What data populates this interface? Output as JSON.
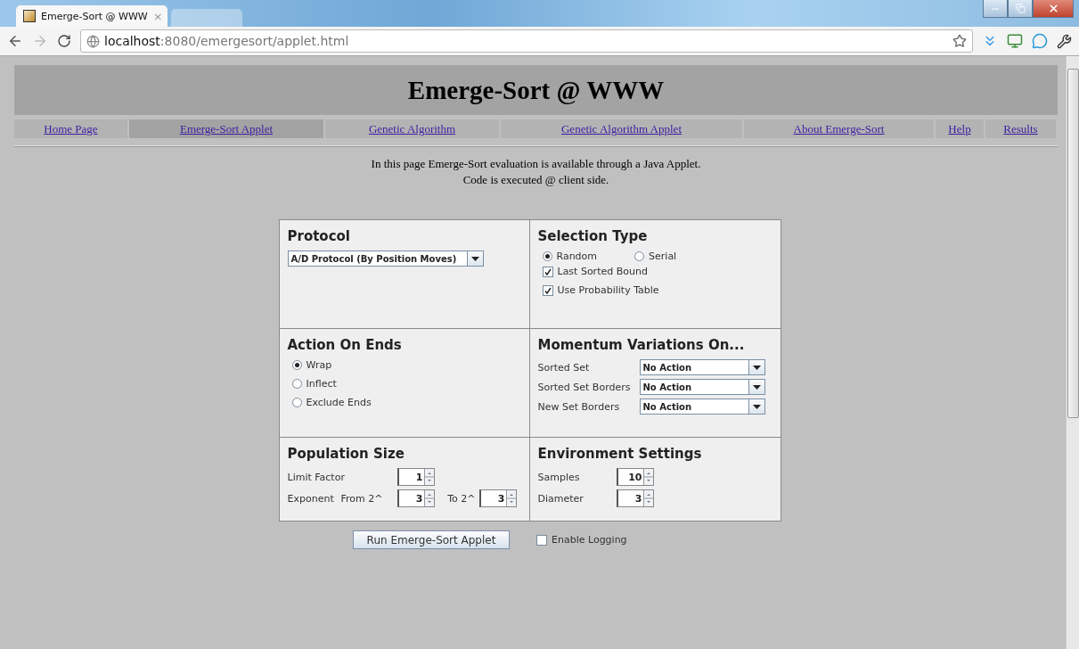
{
  "browser": {
    "tab_title": "Emerge-Sort @ WWW",
    "tab_close": "×",
    "url_host": "localhost",
    "url_rest": ":8080/emergesort/applet.html"
  },
  "page_title": "Emerge-Sort @ WWW",
  "nav": [
    {
      "label": "Home Page",
      "selected": false
    },
    {
      "label": "Emerge-Sort Applet",
      "selected": true
    },
    {
      "label": "Genetic Algorithm",
      "selected": false
    },
    {
      "label": "Genetic Algorithm Applet",
      "selected": false
    },
    {
      "label": "About Emerge-Sort",
      "selected": false
    },
    {
      "label": "Help",
      "selected": false
    },
    {
      "label": "Results",
      "selected": false
    }
  ],
  "intro": [
    "In this page Emerge-Sort evaluation is available through a Java Applet.",
    "Code is executed @ client side."
  ],
  "protocol": {
    "title": "Protocol",
    "dropdown": "A/D Protocol (By Position Moves)"
  },
  "selection_type": {
    "title": "Selection Type",
    "radios": [
      {
        "label": "Random",
        "selected": true
      },
      {
        "label": "Serial",
        "selected": false
      }
    ],
    "checkboxes": [
      {
        "label": "Last Sorted Bound",
        "checked": true
      },
      {
        "label": "Use Probability Table",
        "checked": true
      }
    ]
  },
  "action_on_ends": {
    "title": "Action On Ends",
    "radios": [
      {
        "label": "Wrap",
        "selected": true
      },
      {
        "label": "Inflect",
        "selected": false
      },
      {
        "label": "Exclude Ends",
        "selected": false
      }
    ]
  },
  "momentum": {
    "title": "Momentum Variations On...",
    "rows": [
      {
        "label": "Sorted Set",
        "value": "No Action"
      },
      {
        "label": "Sorted Set Borders",
        "value": "No Action"
      },
      {
        "label": "New Set Borders",
        "value": "No Action"
      }
    ]
  },
  "population": {
    "title": "Population Size",
    "limit_label": "Limit Factor",
    "limit_value": "1",
    "exponent_label": "Exponent",
    "from_label": "From 2^",
    "from_value": "3",
    "to_label": "To 2^",
    "to_value": "3"
  },
  "environment": {
    "title": "Environment Settings",
    "rows": [
      {
        "label": "Samples",
        "value": "10"
      },
      {
        "label": "Diameter",
        "value": "3"
      }
    ]
  },
  "run_button": "Run Emerge-Sort Applet",
  "logging": {
    "label": "Enable Logging",
    "checked": false
  }
}
